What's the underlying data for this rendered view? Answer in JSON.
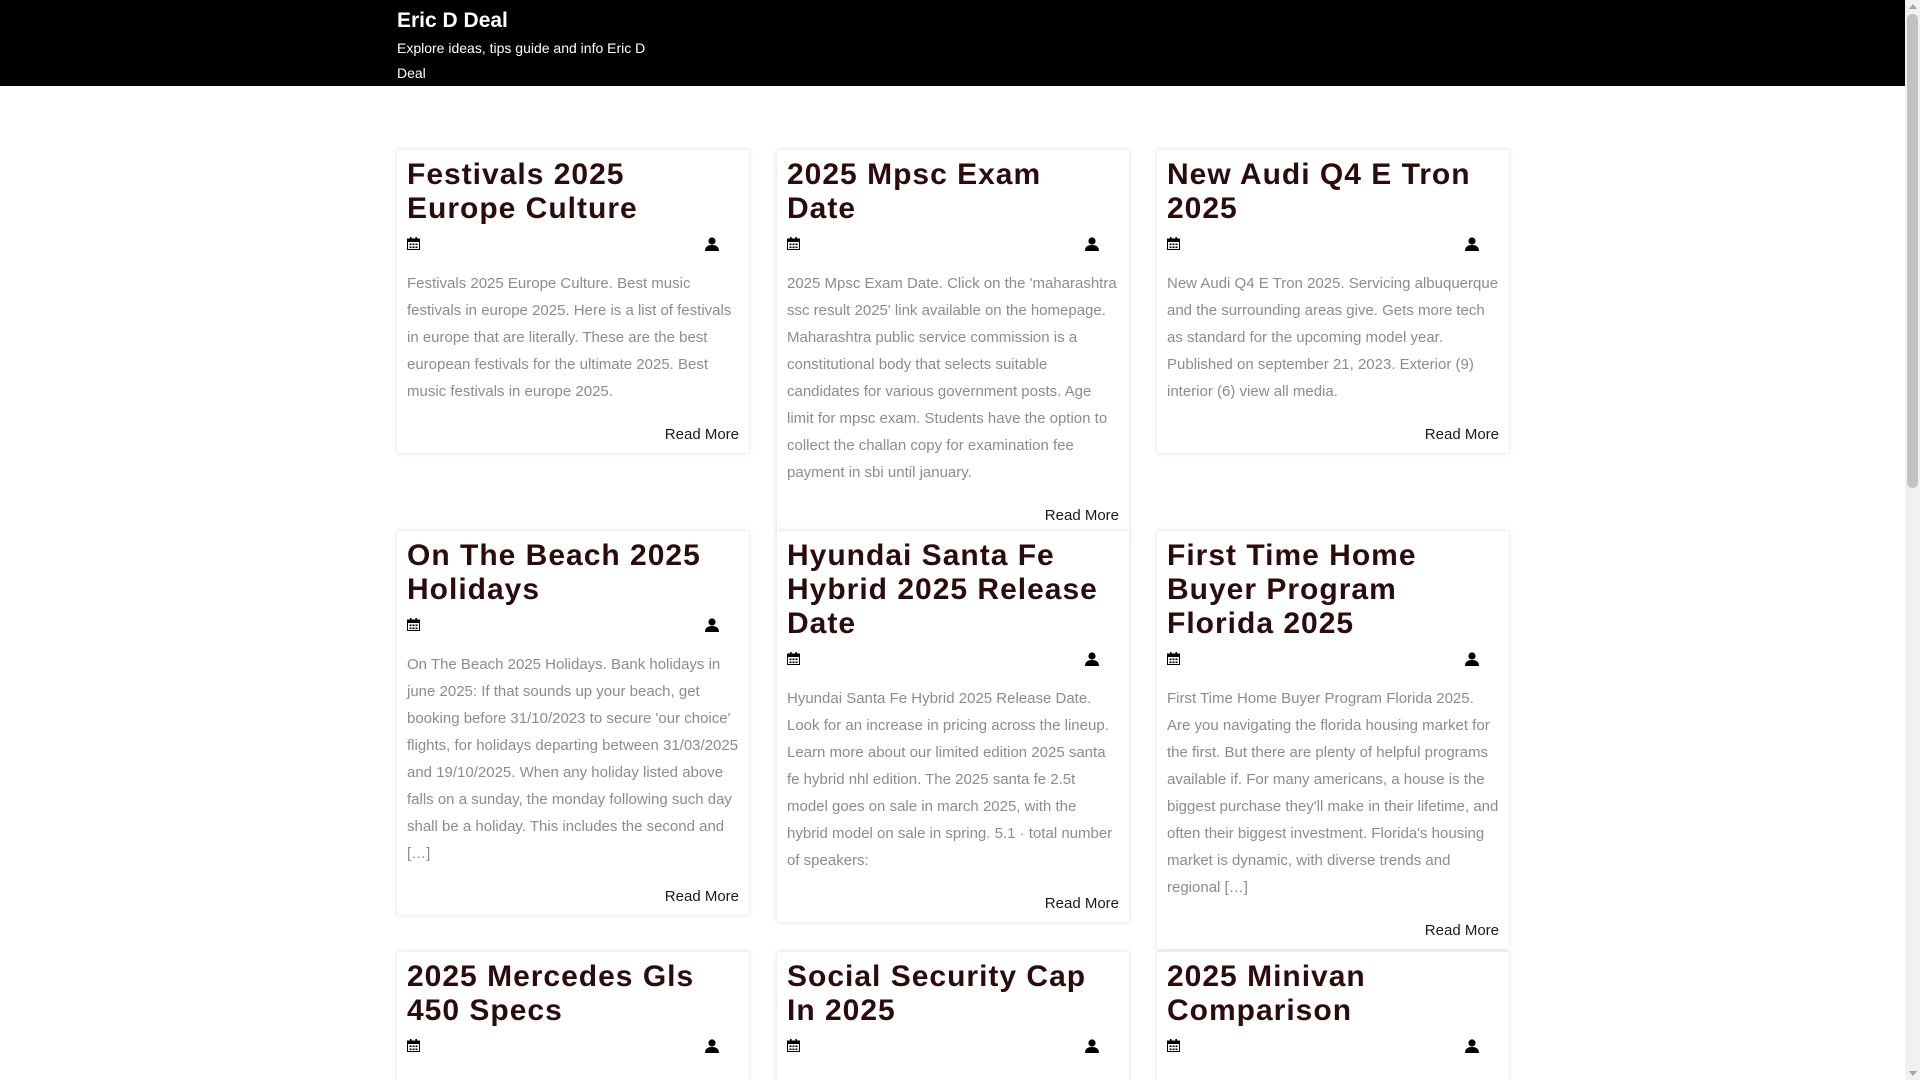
{
  "site": {
    "title": "Eric D Deal",
    "description": "Explore ideas, tips guide and info Eric D Deal"
  },
  "read_more_label": "Read More",
  "posts": [
    {
      "title": "Festivals 2025 Europe Culture",
      "excerpt": "Festivals 2025 Europe Culture. Best music festivals in europe 2025. Here is a list of festivals in europe that are literally. These are the best european festivals for the ultimate 2025. Best music festivals in europe 2025."
    },
    {
      "title": "2025 Mpsc Exam Date",
      "excerpt": "2025 Mpsc Exam Date. Click on the 'maharashtra ssc result 2025' link available on the homepage. Maharashtra public service commission is a constitutional body that selects suitable candidates for various government posts. Age limit for mpsc exam. Students have the option to collect the challan copy for examination fee payment in sbi until january."
    },
    {
      "title": "New Audi Q4 E Tron 2025",
      "excerpt": "New Audi Q4 E Tron 2025. Servicing albuquerque and the surrounding areas give. Gets more tech as standard for the upcoming model year. Published on september 21, 2023. Exterior (9) interior (6) view all media."
    },
    {
      "title": "On The Beach 2025 Holidays",
      "excerpt": "On The Beach 2025 Holidays. Bank holidays in june 2025: If that sounds up your beach, get booking before 31/10/2023 to secure 'our choice' flights, for holidays departing between 31/03/2025 and 19/10/2025. When any holiday listed above falls on a sunday, the monday following such day shall be a holiday. This includes the second and […]"
    },
    {
      "title": "Hyundai Santa Fe Hybrid 2025 Release Date",
      "excerpt": "Hyundai Santa Fe Hybrid 2025 Release Date. Look for an increase in pricing across the lineup. Learn more about our limited edition 2025 santa fe hybrid nhl edition. The 2025 santa fe 2.5t model goes on sale in march 2025, with the hybrid model on sale in spring. 5.1 · total number of speakers:"
    },
    {
      "title": "First Time Home Buyer Program Florida 2025",
      "excerpt": "First Time Home Buyer Program Florida 2025. Are you navigating the florida housing market for the first. But there are plenty of helpful programs available if. For many americans, a house is the biggest purchase they'll make in their lifetime, and often their biggest investment. Florida's housing market is dynamic, with diverse trends and regional […]"
    },
    {
      "title": "2025 Mercedes Gls 450 Specs",
      "excerpt": ""
    },
    {
      "title": "Social Security Cap In 2025",
      "excerpt": ""
    },
    {
      "title": "2025 Minivan Comparison",
      "excerpt": ""
    }
  ],
  "icons": {
    "date": "calendar-icon",
    "author": "user-icon"
  },
  "colors": {
    "header_bg": "#000000",
    "title": "#2b0b0b",
    "excerpt": "#8c8c8c"
  }
}
